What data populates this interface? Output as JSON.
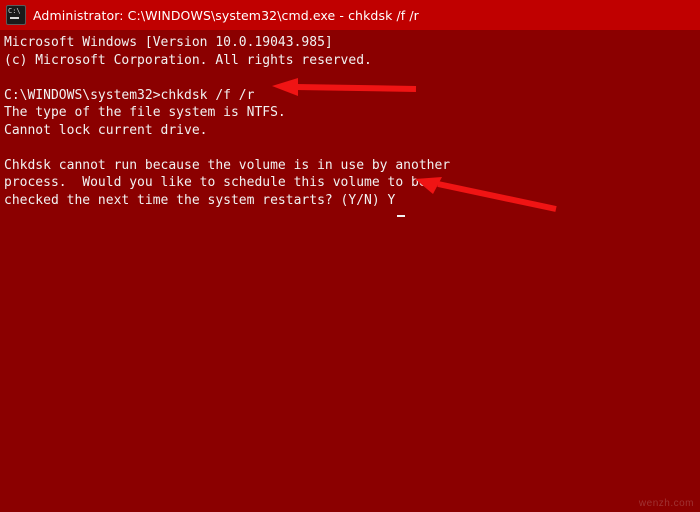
{
  "window": {
    "title": "Administrator: C:\\WINDOWS\\system32\\cmd.exe - chkdsk  /f /r",
    "icon": "cmd-console-icon",
    "title_bar_color": "#c00000",
    "console_background_color": "#8b0000",
    "console_text_color": "#f2f2f2"
  },
  "console": {
    "lines": [
      "Microsoft Windows [Version 10.0.19043.985]",
      "(c) Microsoft Corporation. All rights reserved.",
      "",
      "C:\\WINDOWS\\system32>chkdsk /f /r",
      "The type of the file system is NTFS.",
      "Cannot lock current drive.",
      "",
      "Chkdsk cannot run because the volume is in use by another",
      "process.  Would you like to schedule this volume to be",
      "checked the next time the system restarts? (Y/N) Y"
    ],
    "cursor": "_"
  },
  "annotations": [
    {
      "name": "arrow-to-chkdsk-command",
      "color": "#f01414",
      "points_to": "chkdsk /f /r"
    },
    {
      "name": "arrow-to-yes-answer",
      "color": "#f01414",
      "points_to": "(Y/N) Y"
    }
  ],
  "watermark": {
    "text": "wenzh.com"
  }
}
